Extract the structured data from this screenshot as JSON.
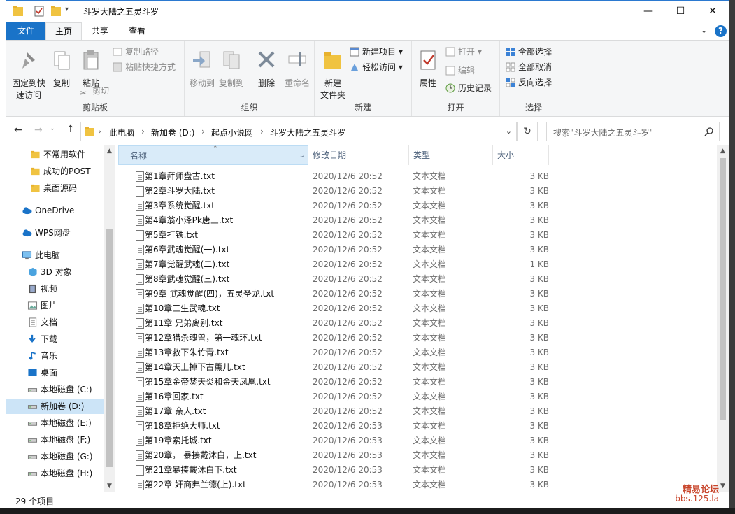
{
  "window": {
    "title": "斗罗大陆之五灵斗罗"
  },
  "menu": {
    "file": "文件",
    "home": "主页",
    "share": "共享",
    "view": "查看"
  },
  "ribbon": {
    "clipboard": {
      "label": "剪贴板",
      "pin": "固定到快速访问",
      "pin_line1": "固定到快",
      "pin_line2": "速访问",
      "copy": "复制",
      "paste": "粘贴",
      "copy_path": "复制路径",
      "paste_shortcut": "粘贴快捷方式",
      "cut": "剪切"
    },
    "organize": {
      "label": "组织",
      "move_to": "移动到",
      "copy_to": "复制到",
      "delete": "删除",
      "rename": "重命名"
    },
    "new": {
      "label": "新建",
      "new_folder_line1": "新建",
      "new_folder_line2": "文件夹",
      "new_item": "新建项目",
      "easy_access": "轻松访问"
    },
    "open": {
      "label": "打开",
      "properties": "属性",
      "open": "打开",
      "edit": "编辑",
      "history": "历史记录"
    },
    "select": {
      "label": "选择",
      "select_all": "全部选择",
      "select_none": "全部取消",
      "invert": "反向选择"
    }
  },
  "address": {
    "crumbs": [
      "此电脑",
      "新加卷 (D:)",
      "起点小说网",
      "斗罗大陆之五灵斗罗"
    ]
  },
  "search": {
    "placeholder": "搜索\"斗罗大陆之五灵斗罗\""
  },
  "nav": {
    "items": [
      "不常用软件",
      "成功的POST",
      "桌面源码",
      "OneDrive",
      "WPS网盘",
      "此电脑",
      "3D 对象",
      "视频",
      "图片",
      "文档",
      "下载",
      "音乐",
      "桌面",
      "本地磁盘 (C:)",
      "新加卷 (D:)",
      "本地磁盘 (E:)",
      "本地磁盘 (F:)",
      "本地磁盘 (G:)",
      "本地磁盘 (H:)"
    ],
    "selected": "新加卷 (D:)"
  },
  "columns": {
    "name": "名称",
    "date": "修改日期",
    "type": "类型",
    "size": "大小"
  },
  "files": [
    {
      "name": "第1章拜师盘古.txt",
      "date": "2020/12/6 20:52",
      "type": "文本文档",
      "size": "3 KB"
    },
    {
      "name": "第2章斗罗大陆.txt",
      "date": "2020/12/6 20:52",
      "type": "文本文档",
      "size": "3 KB"
    },
    {
      "name": "第3章系统觉醒.txt",
      "date": "2020/12/6 20:52",
      "type": "文本文档",
      "size": "3 KB"
    },
    {
      "name": "第4章翁小泽Pk唐三.txt",
      "date": "2020/12/6 20:52",
      "type": "文本文档",
      "size": "3 KB"
    },
    {
      "name": "第5章打铁.txt",
      "date": "2020/12/6 20:52",
      "type": "文本文档",
      "size": "3 KB"
    },
    {
      "name": "第6章武魂觉醒(一).txt",
      "date": "2020/12/6 20:52",
      "type": "文本文档",
      "size": "3 KB"
    },
    {
      "name": "第7章觉醒武魂(二).txt",
      "date": "2020/12/6 20:52",
      "type": "文本文档",
      "size": "1 KB"
    },
    {
      "name": "第8章武魂觉醒(三).txt",
      "date": "2020/12/6 20:52",
      "type": "文本文档",
      "size": "3 KB"
    },
    {
      "name": "第9章 武魂觉醒(四)，五灵圣龙.txt",
      "date": "2020/12/6 20:52",
      "type": "文本文档",
      "size": "3 KB"
    },
    {
      "name": "第10章三生武魂.txt",
      "date": "2020/12/6 20:52",
      "type": "文本文档",
      "size": "3 KB"
    },
    {
      "name": "第11章 兄弟离别.txt",
      "date": "2020/12/6 20:52",
      "type": "文本文档",
      "size": "3 KB"
    },
    {
      "name": "第12章猎杀魂兽，第一魂环.txt",
      "date": "2020/12/6 20:52",
      "type": "文本文档",
      "size": "3 KB"
    },
    {
      "name": "第13章救下朱竹青.txt",
      "date": "2020/12/6 20:52",
      "type": "文本文档",
      "size": "3 KB"
    },
    {
      "name": "第14章天上掉下古薰儿.txt",
      "date": "2020/12/6 20:52",
      "type": "文本文档",
      "size": "3 KB"
    },
    {
      "name": "第15章金帝焚天炎和金天凤凰.txt",
      "date": "2020/12/6 20:52",
      "type": "文本文档",
      "size": "3 KB"
    },
    {
      "name": "第16章回家.txt",
      "date": "2020/12/6 20:52",
      "type": "文本文档",
      "size": "3 KB"
    },
    {
      "name": "第17章 亲人.txt",
      "date": "2020/12/6 20:52",
      "type": "文本文档",
      "size": "3 KB"
    },
    {
      "name": "第18章拒绝大师.txt",
      "date": "2020/12/6 20:53",
      "type": "文本文档",
      "size": "3 KB"
    },
    {
      "name": "第19章索托城.txt",
      "date": "2020/12/6 20:53",
      "type": "文本文档",
      "size": "3 KB"
    },
    {
      "name": "第20章， 暴揍戴沐白，上.txt",
      "date": "2020/12/6 20:53",
      "type": "文本文档",
      "size": "3 KB"
    },
    {
      "name": "第21章暴揍戴沐白下.txt",
      "date": "2020/12/6 20:53",
      "type": "文本文档",
      "size": "3 KB"
    },
    {
      "name": "第22章 奸商弗兰德(上).txt",
      "date": "2020/12/6 20:53",
      "type": "文本文档",
      "size": "3 KB"
    }
  ],
  "status": {
    "count": "29 个项目"
  },
  "watermark": {
    "line1": "精易论坛",
    "line2": "bbs.125.la"
  },
  "colors": {
    "accent": "#1a73c8",
    "selection": "#cce4f7",
    "header_hover": "#d9ebf9"
  }
}
